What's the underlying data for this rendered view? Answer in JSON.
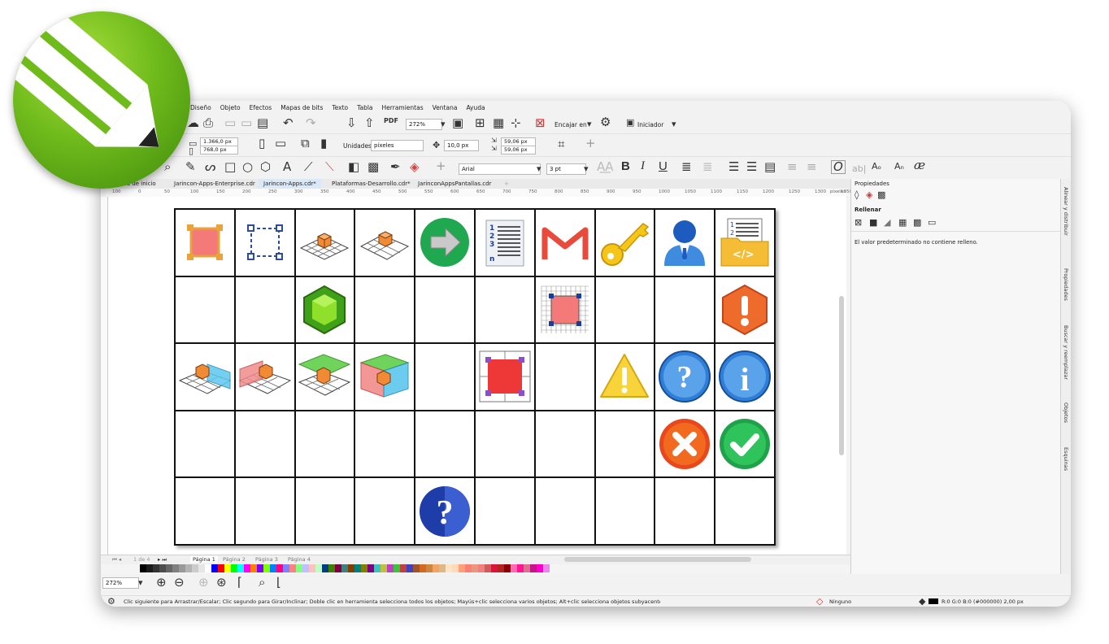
{
  "menu": [
    "Diseño",
    "Objeto",
    "Efectos",
    "Mapas de bits",
    "Texto",
    "Tabla",
    "Herramientas",
    "Ventana",
    "Ayuda"
  ],
  "toolbar1": {
    "zoom": "272%",
    "snap_label": "Encajar en",
    "launcher_label": "Iniciador"
  },
  "toolbar2": {
    "width": "1.366,0 px",
    "height": "768,0 px",
    "units_label": "Unidades:",
    "units_value": "píxeles",
    "nudge": "10,0 px",
    "dup_x": "59,06 px",
    "dup_y": "59,06 px"
  },
  "toolbar3": {
    "font": "Arial",
    "size": "3 pt"
  },
  "tabs": [
    {
      "label": "Guía de inicio",
      "active": false
    },
    {
      "label": "Jarincon-Apps-Enterprise.cdr",
      "active": false
    },
    {
      "label": "Jarincon-Apps.cdr*",
      "active": true
    },
    {
      "label": "Plataformas-Desarrollo.cdr*",
      "active": false
    },
    {
      "label": "JarinconAppsPantallas.cdr",
      "active": false
    }
  ],
  "ruler": {
    "marks": [
      "100",
      "0",
      "50",
      "100",
      "150",
      "200",
      "250",
      "300",
      "350",
      "400",
      "450",
      "500",
      "550",
      "600",
      "650",
      "700",
      "750",
      "800",
      "850",
      "900",
      "950",
      "1000",
      "1050",
      "1100",
      "1150",
      "1200",
      "1250",
      "1300",
      "1350"
    ],
    "unit": "píxeles"
  },
  "grid": {
    "rows": [
      [
        "square-selected",
        "square-dashed",
        "cube-grid",
        "cube-grid-rotated",
        "arrow-right",
        "numbered-list",
        "gmail",
        "key",
        "user",
        "code-folder"
      ],
      [
        "",
        "",
        "emerald",
        "",
        "",
        "",
        "grid-square",
        "",
        "",
        "hexagon-warning"
      ],
      [
        "cube-blue-plane",
        "cube-red-plane",
        "cube-green-top",
        "box-red-blue",
        "",
        "square-guides",
        "",
        "warning-triangle",
        "help-circle",
        "info-circle"
      ],
      [
        "",
        "",
        "",
        "",
        "",
        "",
        "",
        "",
        "close-circle",
        "check-circle"
      ],
      [
        "",
        "",
        "",
        "",
        "question-dark",
        "",
        "",
        "",
        "",
        ""
      ]
    ]
  },
  "pages": {
    "counter": "1 de 4",
    "tabs": [
      "Página 1",
      "Página 2",
      "Página 3",
      "Página 4"
    ]
  },
  "palette": [
    "#000000",
    "#1a1a1a",
    "#333333",
    "#4d4d4d",
    "#666666",
    "#808080",
    "#999999",
    "#b3b3b3",
    "#cccccc",
    "#e6e6e6",
    "#ffffff",
    "#0000ff",
    "#ff0000",
    "#ffff00",
    "#00ff00",
    "#00ffff",
    "#ff00ff",
    "#ff8000",
    "#8000ff",
    "#80ff00",
    "#0080ff",
    "#ff0080",
    "#8080ff",
    "#ff8080",
    "#80ff80",
    "#c0c0ff",
    "#ffc0c0",
    "#c0ffc0",
    "#004080",
    "#408000",
    "#800040",
    "#408080",
    "#804000",
    "#008080",
    "#808000",
    "#800080",
    "#40c0c0",
    "#c0c040",
    "#c040c0",
    "#40c040",
    "#c04040",
    "#4040c0",
    "#a0522d",
    "#d2691e",
    "#cd853f",
    "#f4a460",
    "#deb887",
    "#ffe4c4",
    "#ffdab9",
    "#ffa07a",
    "#fa8072",
    "#e9967a",
    "#f08080",
    "#cd5c5c",
    "#dc143c",
    "#b22222",
    "#8b0000",
    "#ff69b4",
    "#ff1493",
    "#db7093",
    "#c71585",
    "#ff00cc",
    "#ee82ee"
  ],
  "zoom_field": "272%",
  "panel": {
    "title": "Propiedades",
    "section": "Rellenar",
    "message": "El valor predeterminado no contiene relleno.",
    "side_tabs": [
      "Alinear y distribuir",
      "Propiedades",
      "Buscar y reemplazar",
      "Objetos",
      "Esquinas"
    ]
  },
  "status": {
    "hint": "Clic siguiente para Arrastrar/Escalar; Clic segundo para Girar/Inclinar; Doble clic en herramienta selecciona todos los objetos; Mayús+clic selecciona varios objetos; Alt+clic selecciona objetos subyacentes",
    "fill": "Ninguno",
    "outline": "R:0 G:0 B:0 (#000000)  2,00 px"
  },
  "colors": {
    "accent": "#6fbb1c",
    "panel_bg": "#f7f7f7"
  }
}
